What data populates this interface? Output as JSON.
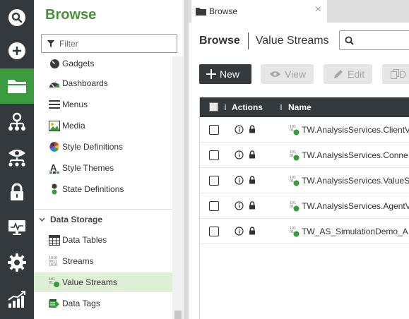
{
  "panel": {
    "title": "Browse",
    "filter_placeholder": "Filter",
    "items": [
      {
        "label": "Gadgets",
        "icon": "gadgets-icon"
      },
      {
        "label": "Dashboards",
        "icon": "dashboards-icon"
      },
      {
        "label": "Menus",
        "icon": "menus-icon"
      },
      {
        "label": "Media",
        "icon": "media-icon"
      },
      {
        "label": "Style Definitions",
        "icon": "style-definitions-icon"
      },
      {
        "label": "Style Themes",
        "icon": "style-themes-icon"
      },
      {
        "label": "State Definitions",
        "icon": "state-definitions-icon"
      }
    ],
    "group": {
      "label": "Data Storage",
      "expanded": true
    },
    "group_items": [
      {
        "label": "Data Tables",
        "icon": "data-tables-icon"
      },
      {
        "label": "Streams",
        "icon": "streams-icon"
      },
      {
        "label": "Value Streams",
        "icon": "value-streams-icon",
        "selected": true
      },
      {
        "label": "Data Tags",
        "icon": "data-tags-icon"
      }
    ]
  },
  "rail": {
    "items": [
      "search-icon",
      "add-icon",
      "folder-icon",
      "hierarchy-icon",
      "monitoring-icon",
      "security-icon",
      "dashboard-monitor-icon",
      "settings-icon",
      "analytics-icon"
    ],
    "active": "folder-icon",
    "active_color": "#3a9b3f"
  },
  "tab": {
    "label": "Browse"
  },
  "breadcrumb": {
    "section": "Browse",
    "current": "Value Streams"
  },
  "toolbar": {
    "new_label": "New",
    "view_label": "View",
    "edit_label": "Edit",
    "duplicate_label": "D"
  },
  "grid": {
    "columns": [
      "Actions",
      "Name"
    ],
    "rows": [
      {
        "name": "TW.AnalysisServices.ClientV"
      },
      {
        "name": "TW.AnalysisServices.Conne"
      },
      {
        "name": "TW.AnalysisServices.ValueS"
      },
      {
        "name": "TW.AnalysisServices.AgentV"
      },
      {
        "name": "TW_AS_SimulationDemo_A"
      }
    ]
  },
  "colors": {
    "brand_green": "#4a8f3a",
    "rail_bg": "#33393d",
    "selected_row": "#dff0d6"
  }
}
